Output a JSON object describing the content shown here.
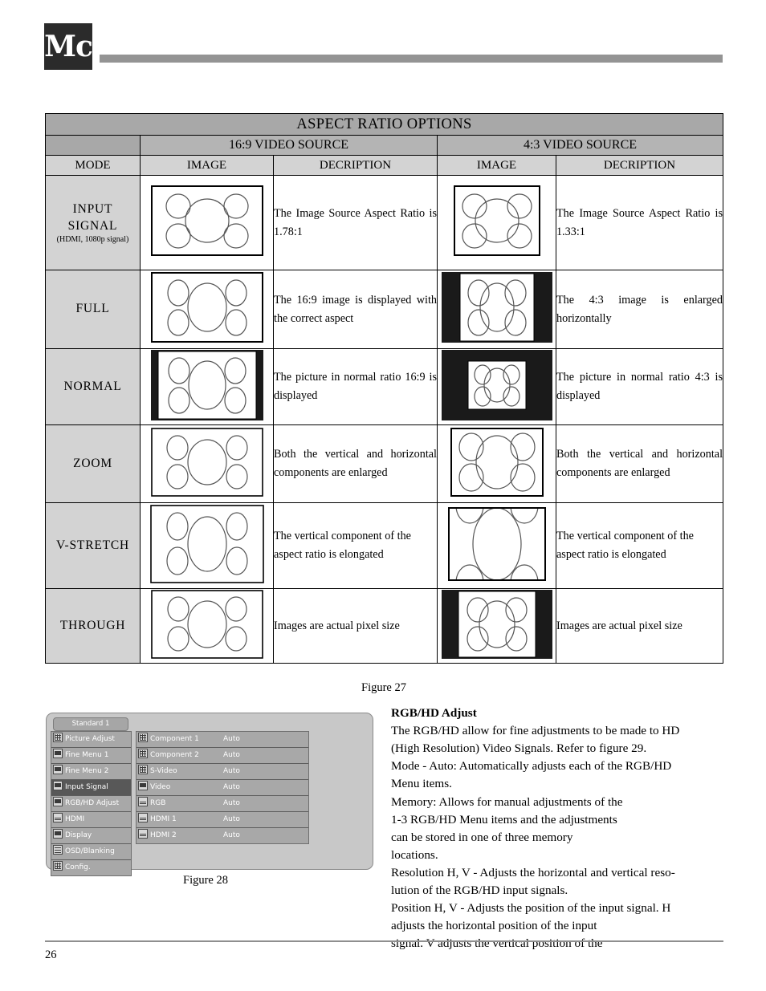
{
  "header": {
    "logo_text": "Mc",
    "logo_name": "mcintosh-logo"
  },
  "table": {
    "title": "ASPECT RATIO OPTIONS",
    "source_headers": [
      "16:9 VIDEO SOURCE",
      "4:3 VIDEO SOURCE"
    ],
    "column_headers": [
      "MODE",
      "IMAGE",
      "DECRIPTION",
      "IMAGE",
      "DECRIPTION"
    ],
    "rows": [
      {
        "mode": "INPUT SIGNAL",
        "mode_line1": "INPUT",
        "mode_line2": "SIGNAL",
        "mode_sub": "(HDMI, 1080p signal)",
        "desc_169": "The Image Source Aspect Ratio is 1.78:1",
        "desc_43": "The Image Source Aspect Ratio is 1.33:1"
      },
      {
        "mode": "FULL",
        "mode_line1": "FULL",
        "mode_line2": "",
        "mode_sub": "",
        "desc_169": "The 16:9 image is displayed with the correct aspect",
        "desc_43": "The 4:3 image is enlarged horizontally"
      },
      {
        "mode": "NORMAL",
        "mode_line1": "NORMAL",
        "mode_line2": "",
        "mode_sub": "",
        "desc_169": "The picture in normal ratio 16:9 is displayed",
        "desc_43": "The picture in normal ratio 4:3 is displayed"
      },
      {
        "mode": "ZOOM",
        "mode_line1": "ZOOM",
        "mode_line2": "",
        "mode_sub": "",
        "desc_169": "Both the vertical and horizontal components are enlarged",
        "desc_43": "Both the vertical and horizontal components are enlarged"
      },
      {
        "mode": "V-STRETCH",
        "mode_line1": "V-STRETCH",
        "mode_line2": "",
        "mode_sub": "",
        "desc_169": "The vertical component of the aspect ratio is elongated",
        "desc_43": "The vertical component of the aspect ratio is elongated"
      },
      {
        "mode": "THROUGH",
        "mode_line1": "THROUGH",
        "mode_line2": "",
        "mode_sub": "",
        "desc_169": "Images are actual pixel size",
        "desc_43": "Images are actual pixel size"
      }
    ]
  },
  "figures": {
    "fig27_caption": "Figure 27",
    "fig28_caption": "Figure 28"
  },
  "osd": {
    "preset_label": "Standard 1",
    "left_menu": [
      {
        "label": "Picture Adjust",
        "icon": "grid-icon",
        "selected": false
      },
      {
        "label": "Fine Menu 1",
        "icon": "arrows-icon",
        "selected": false
      },
      {
        "label": "Fine Menu 2",
        "icon": "arrows-icon",
        "selected": false
      },
      {
        "label": "Input Signal",
        "icon": "input-icon",
        "selected": true
      },
      {
        "label": "RGB/HD Adjust",
        "icon": "monitor-icon",
        "selected": false
      },
      {
        "label": "HDMI",
        "icon": "connector-icon",
        "selected": false
      },
      {
        "label": "Display",
        "icon": "display-icon",
        "selected": false
      },
      {
        "label": "OSD/Blanking",
        "icon": "list-icon",
        "selected": false
      },
      {
        "label": "Config.",
        "icon": "config-icon",
        "selected": false
      }
    ],
    "right_rows": [
      {
        "label": "Component 1",
        "value": "Auto",
        "icon": "component-icon"
      },
      {
        "label": "Component 2",
        "value": "Auto",
        "icon": "component-icon"
      },
      {
        "label": "S-Video",
        "value": "Auto",
        "icon": "svideo-icon"
      },
      {
        "label": "Video",
        "value": "Auto",
        "icon": "video-icon"
      },
      {
        "label": "RGB",
        "value": "Auto",
        "icon": "rgb-icon"
      },
      {
        "label": "HDMI 1",
        "value": "Auto",
        "icon": "hdmi-icon"
      },
      {
        "label": "HDMI 2",
        "value": "Auto",
        "icon": "hdmi-icon"
      }
    ]
  },
  "body_text": {
    "heading": "RGB/HD Adjust",
    "line1": "The RGB/HD allow for fine adjustments to be made to HD",
    "line2": "(High Resolution) Video Signals. Refer to figure 29.",
    "line3": "Mode - Auto: Automatically adjusts each of the RGB/HD",
    "line4": "Menu items.",
    "line5": "Memory: Allows for manual adjustments of the",
    "line6": "1-3      RGB/HD Menu items and the adjustments",
    "line7": "can be stored in one of three memory",
    "line8": "locations.",
    "line9": "Resolution H, V - Adjusts the horizontal and vertical reso-",
    "line10": "lution of the RGB/HD input signals.",
    "line11": "Position H, V - Adjusts the position of the input signal. H",
    "line12": "adjusts the horizontal position of the input",
    "line13": "signal. V adjusts the vertical position of the"
  },
  "footer": {
    "page_number": "26"
  },
  "colors": {
    "title_band": "#a8a8a8",
    "source_band": "#b4b4b4",
    "subhead_band": "#d3d3d3",
    "mode_cell": "#d3d3d3",
    "rule": "#949494",
    "osd_bg": "#c8c8c8",
    "osd_item": "#a8a8a8",
    "osd_selected": "#585858"
  }
}
